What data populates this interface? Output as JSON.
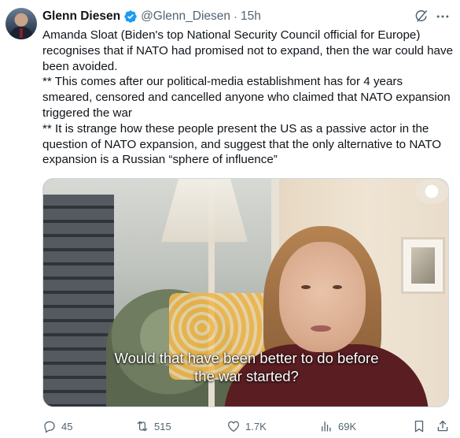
{
  "author": {
    "name": "Glenn Diesen",
    "handle": "@Glenn_Diesen",
    "time": "15h"
  },
  "tweet": {
    "paragraphs": [
      "Amanda Sloat (Biden's top National Security Council official for Europe) recognises that if NATO had promised not to expand, then the war could have been avoided.",
      "** This comes after our political-media establishment has for 4 years smeared, censored and cancelled anyone who claimed that NATO expansion triggered the war",
      "** It is strange how these people present the US as a passive actor in the question of NATO expansion, and suggest that the only alternative to NATO expansion is a Russian “sphere of influence”"
    ]
  },
  "media": {
    "caption_line1": "Would that have been better to do before",
    "caption_line2": "the war started?"
  },
  "actions": {
    "replies": "45",
    "reposts": "515",
    "likes": "1.7K",
    "views": "69K"
  },
  "icons": {
    "verified": "verified-badge-icon",
    "grok": "grok-icon",
    "more": "more-icon",
    "reply": "reply-icon",
    "repost": "repost-icon",
    "like": "like-icon",
    "views": "views-icon",
    "bookmark": "bookmark-icon",
    "share": "share-icon"
  },
  "colors": {
    "verified": "#1d9bf0",
    "secondary_text": "#536471",
    "primary_text": "#0f1419"
  }
}
